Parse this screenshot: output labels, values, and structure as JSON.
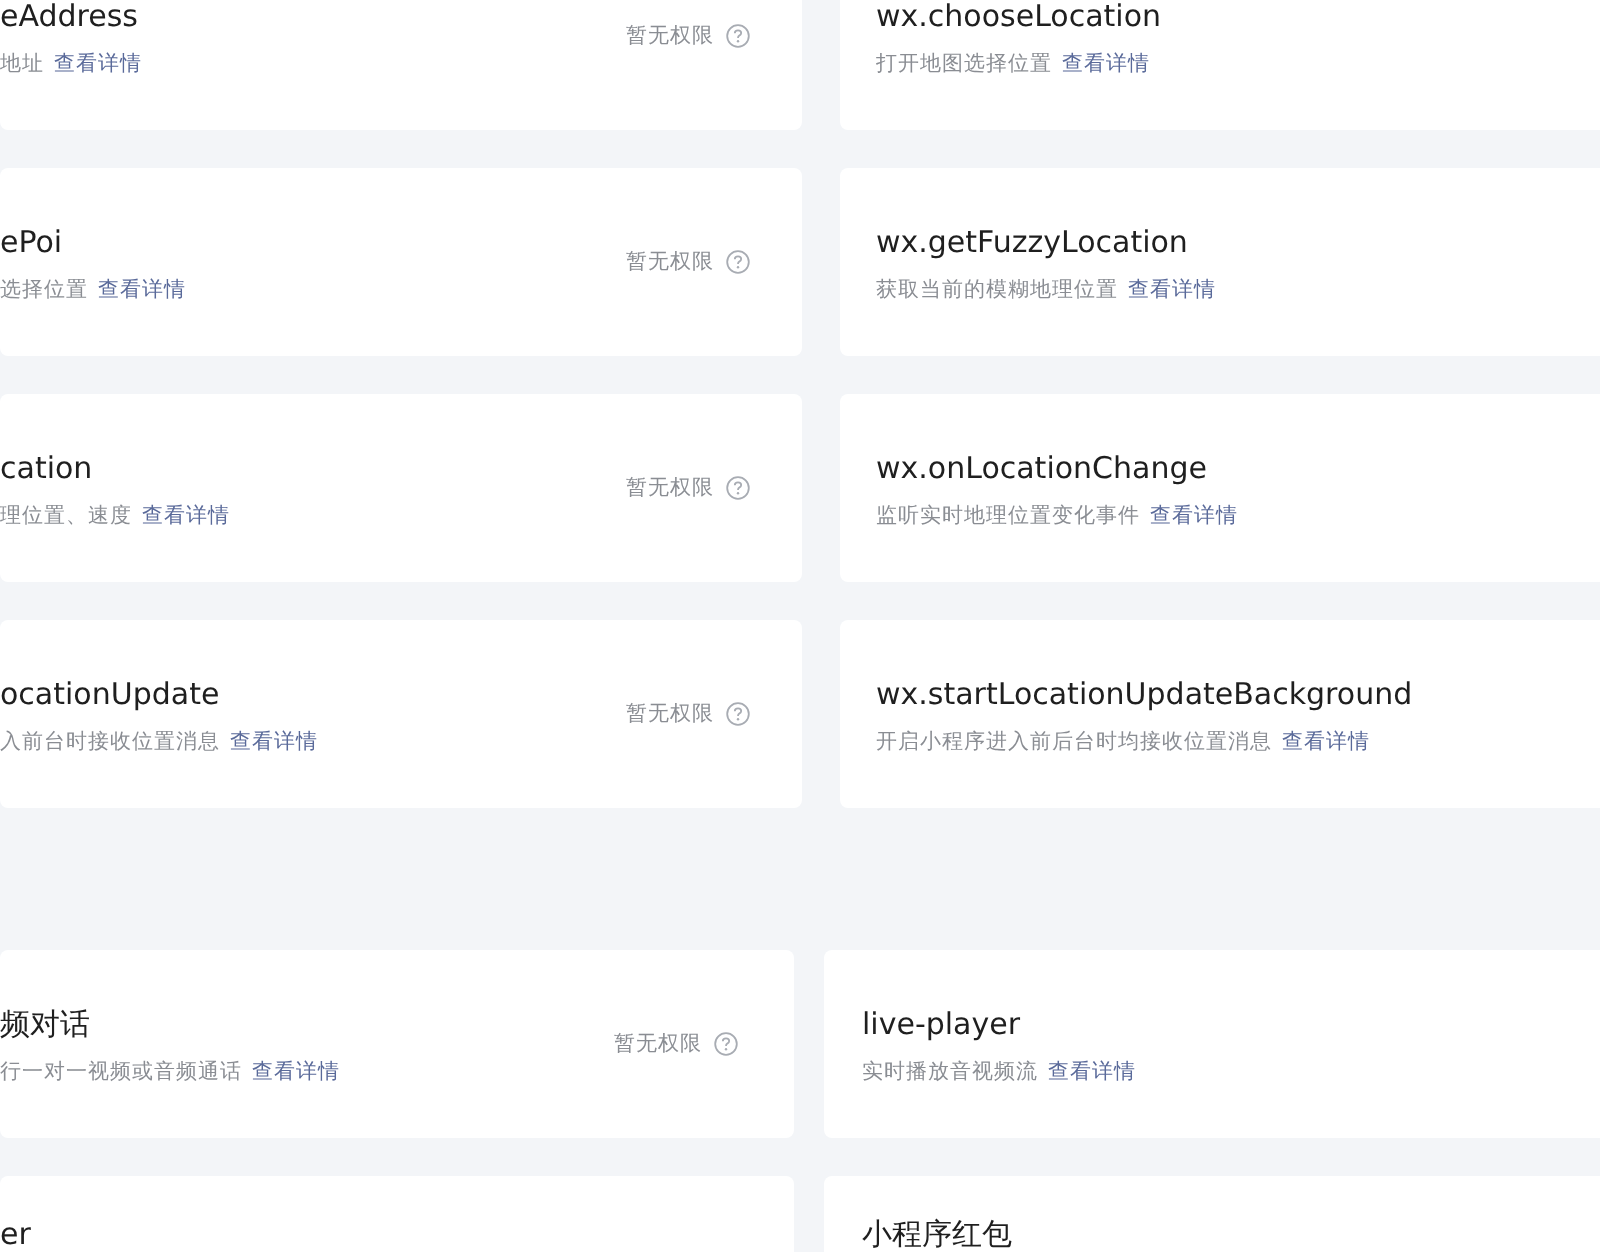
{
  "sections": [
    {
      "cards": [
        {
          "title": "eAddress",
          "description": "地址",
          "link": "查看详情",
          "status": "暂无权限"
        },
        {
          "title": "wx.chooseLocation",
          "description": "打开地图选择位置",
          "link": "查看详情"
        },
        {
          "title": "ePoi",
          "description": "选择位置",
          "link": "查看详情",
          "status": "暂无权限"
        },
        {
          "title": "wx.getFuzzyLocation",
          "description": "获取当前的模糊地理位置",
          "link": "查看详情"
        },
        {
          "title": "cation",
          "description": "理位置、速度",
          "link": "查看详情",
          "status": "暂无权限"
        },
        {
          "title": "wx.onLocationChange",
          "description": "监听实时地理位置变化事件",
          "link": "查看详情"
        },
        {
          "title": "ocationUpdate",
          "description": "入前台时接收位置消息",
          "link": "查看详情",
          "status": "暂无权限"
        },
        {
          "title": "wx.startLocationUpdateBackground",
          "description": "开启小程序进入前后台时均接收位置消息",
          "link": "查看详情"
        }
      ]
    },
    {
      "cards": [
        {
          "title": "频对话",
          "description": "行一对一视频或音频通话",
          "link": "查看详情",
          "status": "暂无权限"
        },
        {
          "title": "live-player",
          "description": "实时播放音视频流",
          "link": "查看详情"
        },
        {
          "title": "er"
        },
        {
          "title": "小程序红包"
        }
      ]
    }
  ]
}
